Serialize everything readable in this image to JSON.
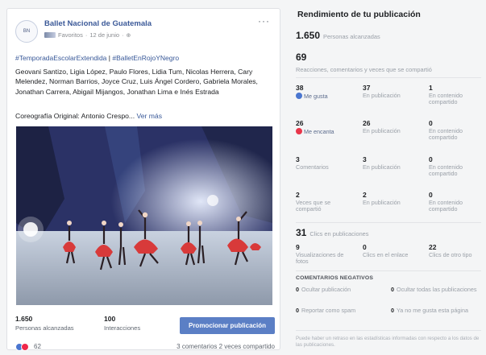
{
  "post": {
    "page_name": "Ballet Nacional de Guatemala",
    "avatar_text": "BN",
    "meta_label": "Favoritos",
    "date": "12 de junio",
    "more_icon": "ellipsis-icon",
    "hashtag1": "#TemporadaEscolarExtendida",
    "hashtag_sep": "|",
    "hashtag2": "#BalletEnRojoYNegro",
    "body": "Geovani Santizo, Ligia López, Paulo Flores, Lidia Tum, Nicolas Herrera, Cary Melendez, Norman Barrios, Joyce Cruz, Luis Ángel Cordero, Gabriela Morales, Jonathan Carrera, Abigail Mijangos, Jonathan Lima e Inés Estrada",
    "choreo": "Coreografía Original: Antonio Crespo...",
    "see_more": "Ver más",
    "stats": {
      "reach_value": "1.650",
      "reach_label": "Personas alcanzadas",
      "interactions_value": "100",
      "interactions_label": "Interacciones"
    },
    "promote_label": "Promocionar publicación",
    "reactions_count": "62",
    "comments": "3 comentarios",
    "shares": "2 veces compartido"
  },
  "performance": {
    "title": "Rendimiento de tu publicación",
    "reach_value": "1.650",
    "reach_label": "Personas alcanzadas",
    "engagement_value": "69",
    "engagement_label": "Reacciones, comentarios y veces que se compartió",
    "rows": [
      [
        {
          "value": "38",
          "label": "Me gusta",
          "icon": "like-icon"
        },
        {
          "value": "37",
          "label": "En publicación"
        },
        {
          "value": "1",
          "label": "En contenido compartido"
        }
      ],
      [
        {
          "value": "26",
          "label": "Me encanta",
          "icon": "love-icon"
        },
        {
          "value": "26",
          "label": "En publicación"
        },
        {
          "value": "0",
          "label": "En contenido compartido"
        }
      ],
      [
        {
          "value": "3",
          "label": "Comentarios"
        },
        {
          "value": "3",
          "label": "En publicación"
        },
        {
          "value": "0",
          "label": "En contenido compartido"
        }
      ],
      [
        {
          "value": "2",
          "label": "Veces que se compartió"
        },
        {
          "value": "2",
          "label": "En publicación"
        },
        {
          "value": "0",
          "label": "En contenido compartido"
        }
      ]
    ],
    "clicks_value": "31",
    "clicks_label": "Clics en publicaciones",
    "click_rows": [
      {
        "value": "9",
        "label": "Visualizaciones de fotos"
      },
      {
        "value": "0",
        "label": "Clics en el enlace"
      },
      {
        "value": "22",
        "label": "Clics de otro tipo"
      }
    ],
    "negative_title": "COMENTARIOS NEGATIVOS",
    "negative": [
      {
        "value": "0",
        "label": "Ocultar publicación"
      },
      {
        "value": "0",
        "label": "Ocultar todas las publicaciones"
      },
      {
        "value": "0",
        "label": "Reportar como spam"
      },
      {
        "value": "0",
        "label": "Ya no me gusta esta página"
      }
    ],
    "note": "Puede haber un retraso en las estadísticas informadas con respecto a los datos de las publicaciones."
  },
  "colors": {
    "link": "#385898",
    "promote_button": "#5b7fc5",
    "like": "#4a76d0",
    "love": "#e8364a"
  }
}
